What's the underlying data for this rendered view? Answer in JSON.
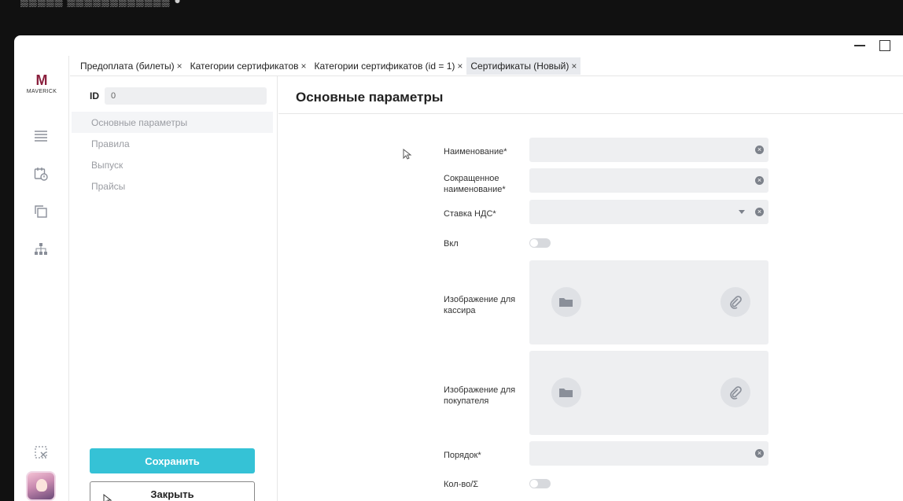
{
  "window": {
    "controls": [
      "minimize",
      "maximize"
    ]
  },
  "logo": {
    "mark": "M",
    "word": "MAVERICK"
  },
  "tabs": [
    {
      "label": "Предоплата (билеты)",
      "close": "×"
    },
    {
      "label": "Категории сертификатов",
      "close": "×"
    },
    {
      "label": "Категории сертификатов (id = 1)",
      "close": "×"
    },
    {
      "label": "Сертификаты (Новый)",
      "close": "×",
      "active": true
    }
  ],
  "side": {
    "id_label": "ID",
    "id_value": "0",
    "items": [
      "Основные параметры",
      "Правила",
      "Выпуск",
      "Прайсы"
    ],
    "save_label": "Сохранить",
    "close_label": "Закрыть"
  },
  "main": {
    "title": "Основные параметры",
    "fields": {
      "name": "Наименование*",
      "short_name": "Сокращенное наименование*",
      "vat": "Ставка НДС*",
      "enabled": "Вкл",
      "image_cashier": "Изображение для кассира",
      "image_buyer": "Изображение для покупателя",
      "order": "Порядок*",
      "qty": "Кол-во/Σ"
    }
  },
  "colors": {
    "accent": "#35c2d6",
    "logo": "#8a1f3d"
  },
  "icons": [
    "list-icon",
    "calendar-icon",
    "copy-icon",
    "org-chart-icon",
    "exit-fullscreen-icon",
    "folder-icon",
    "paperclip-icon"
  ]
}
